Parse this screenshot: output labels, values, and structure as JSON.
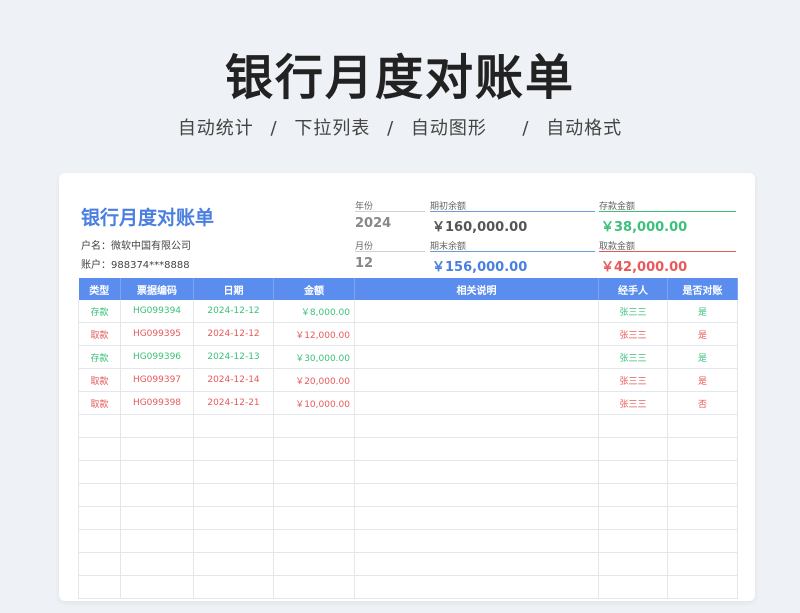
{
  "header": {
    "title": "银行月度对账单",
    "features": [
      "自动统计",
      "下拉列表",
      "自动图形",
      "自动格式"
    ],
    "separator": "/"
  },
  "sheet": {
    "title": "银行月度对账单",
    "account_name": "户名：微软中国有限公司",
    "account_no": "账户：988374***8888"
  },
  "info": {
    "year_label": "年份",
    "year": "2024",
    "month_label": "月份",
    "month": "12",
    "opening_label": "期初余额",
    "opening": "￥160,000.00",
    "closing_label": "期末余额",
    "closing": "￥156,000.00",
    "deposit_label": "存款金额",
    "deposit": "￥38,000.00",
    "withdraw_label": "取款金额",
    "withdraw": "￥42,000.00"
  },
  "colors": {
    "accent": "#5b8def",
    "deposit_green": "#3cc07c",
    "withdraw_red": "#e85a5a",
    "title_blue": "#4a7fe0"
  },
  "table": {
    "columns": [
      "类型",
      "票据编码",
      "日期",
      "金额",
      "相关说明",
      "经手人",
      "是否对账"
    ],
    "rows": [
      {
        "type": "存款",
        "code": "HG099394",
        "date": "2024-12-12",
        "amount": "￥8,000.00",
        "note": "",
        "handler": "张三三",
        "reconciled": "是",
        "color": "green"
      },
      {
        "type": "取款",
        "code": "HG099395",
        "date": "2024-12-12",
        "amount": "￥12,000.00",
        "note": "",
        "handler": "张三三",
        "reconciled": "是",
        "color": "red"
      },
      {
        "type": "存款",
        "code": "HG099396",
        "date": "2024-12-13",
        "amount": "￥30,000.00",
        "note": "",
        "handler": "张三三",
        "reconciled": "是",
        "color": "green"
      },
      {
        "type": "取款",
        "code": "HG099397",
        "date": "2024-12-14",
        "amount": "￥20,000.00",
        "note": "",
        "handler": "张三三",
        "reconciled": "是",
        "color": "red"
      },
      {
        "type": "取款",
        "code": "HG099398",
        "date": "2024-12-21",
        "amount": "￥10,000.00",
        "note": "",
        "handler": "张三三",
        "reconciled": "否",
        "color": "red"
      }
    ],
    "empty_rows": 8
  }
}
